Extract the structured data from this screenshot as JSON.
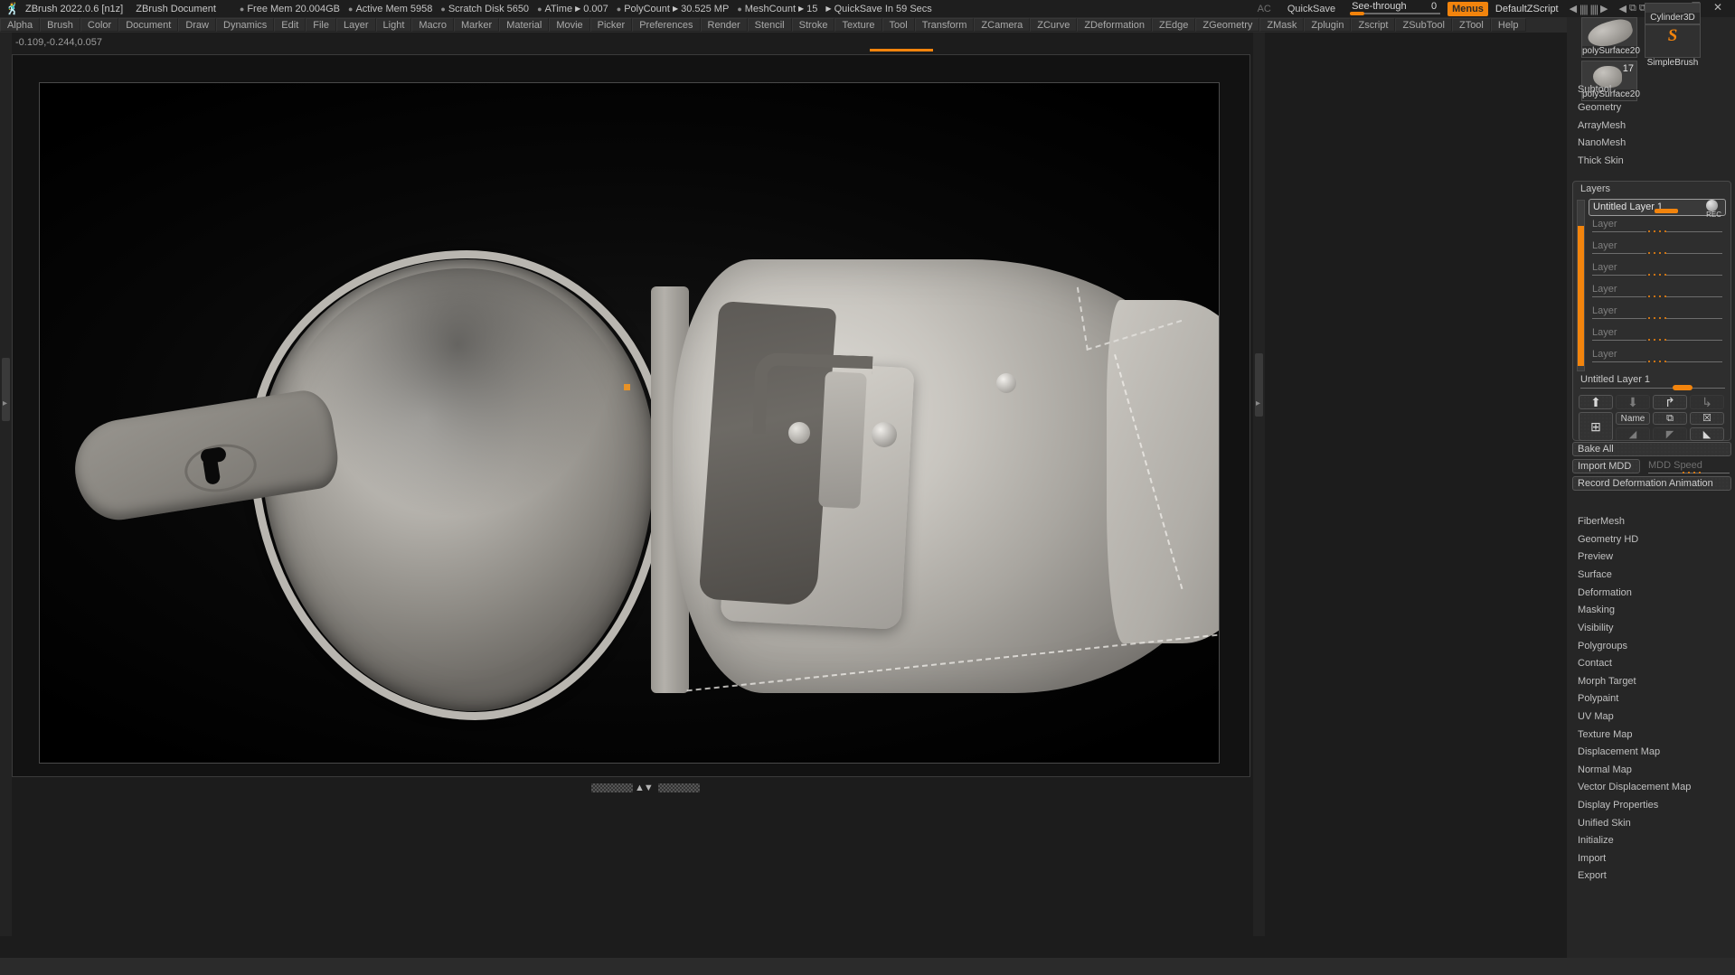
{
  "app": {
    "logo_icon": "zbrush-logo-icon",
    "version": "ZBrush 2022.0.6 [n1z]",
    "document_title": "ZBrush Document"
  },
  "titlebar": {
    "stats": [
      {
        "label": "Free Mem",
        "value": "20.004GB",
        "bullet": "•"
      },
      {
        "label": "Active Mem",
        "value": "5958",
        "bullet": "•"
      },
      {
        "label": "Scratch Disk",
        "value": "5650",
        "bullet": "•"
      },
      {
        "label": "ATime",
        "value": "0.007",
        "bullet": "•",
        "arrow": "▶"
      },
      {
        "label": "PolyCount",
        "value": "30.525 MP",
        "bullet": "•",
        "arrow": "▶"
      },
      {
        "label": "MeshCount",
        "value": "15",
        "bullet": "•",
        "arrow": "▶"
      },
      {
        "label": "QuickSave In 59 Secs",
        "value": "",
        "bullet": "",
        "arrow": "▶"
      }
    ],
    "ac_label": "AC",
    "quicksave_label": "QuickSave",
    "see_through_label": "See-through",
    "see_through_value": "0",
    "menus_label": "Menus",
    "zscript_label": "DefaultZScript",
    "minimize_icon": "minimize-icon",
    "restore_icon": "restore-icon",
    "close_icon": "close-icon",
    "accent_color": "#f2840d"
  },
  "menubar": {
    "items": [
      "Alpha",
      "Brush",
      "Color",
      "Document",
      "Draw",
      "Dynamics",
      "Edit",
      "File",
      "Layer",
      "Light",
      "Macro",
      "Marker",
      "Material",
      "Movie",
      "Picker",
      "Preferences",
      "Render",
      "Stencil",
      "Stroke",
      "Texture",
      "Tool",
      "Transform",
      "ZCamera",
      "ZCurve",
      "ZDeformation",
      "ZEdge",
      "ZGeometry",
      "ZMask",
      "Zplugin",
      "Zscript",
      "ZSubTool",
      "ZTool",
      "Help"
    ]
  },
  "canvas": {
    "coordinate_readout": "-0.109,-0.244,0.057",
    "subject": "leather saddlebag / holster 3d sculpt"
  },
  "sidebar": {
    "shelf": {
      "tool_thumb_1_label": "polySurface20",
      "tool_thumb_2_label": "polySurface20",
      "tool_thumb_2_count": "17",
      "brush_top_label": "Cylinder3D",
      "brush_label": "SimpleBrush"
    },
    "items_top": [
      "Subtool",
      "Geometry",
      "ArrayMesh",
      "NanoMesh",
      "Thick Skin"
    ],
    "items_bottom": [
      "FiberMesh",
      "Geometry HD",
      "Preview",
      "Surface",
      "Deformation",
      "Masking",
      "Visibility",
      "Polygroups",
      "Contact",
      "Morph Target",
      "Polypaint",
      "UV Map",
      "Texture Map",
      "Displacement Map",
      "Normal Map",
      "Vector Displacement Map",
      "Display Properties",
      "Unified Skin",
      "Initialize",
      "Import",
      "Export"
    ]
  },
  "layers_palette": {
    "title": "Layers",
    "active_layer_name": "Untitled Layer 1",
    "rec_label": "REC",
    "rows": [
      {
        "name": "Untitled Layer 1",
        "active": true
      },
      {
        "name": "Layer",
        "active": false
      },
      {
        "name": "Layer",
        "active": false
      },
      {
        "name": "Layer",
        "active": false
      },
      {
        "name": "Layer",
        "active": false
      },
      {
        "name": "Layer",
        "active": false
      },
      {
        "name": "Layer",
        "active": false
      },
      {
        "name": "Layer",
        "active": false
      }
    ],
    "footer_layer_name": "Untitled Layer 1",
    "buttons_row1": [
      {
        "name": "move-layer-up",
        "glyph": "⬆",
        "dim": false
      },
      {
        "name": "move-layer-down",
        "glyph": "⬇",
        "dim": true
      },
      {
        "name": "split-layer",
        "glyph": "↱",
        "dim": false
      },
      {
        "name": "merge-down-layer",
        "glyph": "↳",
        "dim": true
      }
    ],
    "buttons_row2": [
      {
        "name": "new-layer",
        "glyph": "⊞",
        "dim": false
      },
      {
        "name": "rename-layer",
        "glyph": "Name",
        "dim": false
      },
      {
        "name": "duplicate-layer",
        "glyph": "⧉",
        "dim": false
      },
      {
        "name": "delete-layer",
        "glyph": "☒",
        "dim": false
      }
    ],
    "buttons_row3": [
      {
        "name": "layer-intensity",
        "glyph": "◢",
        "dim": true
      },
      {
        "name": "layer-invert",
        "glyph": "◤",
        "dim": true
      },
      {
        "name": "layer-fill",
        "glyph": "◣",
        "dim": false
      }
    ],
    "bake_all_label": "Bake All",
    "import_mdd_label": "Import MDD",
    "mdd_speed_label": "MDD Speed",
    "record_deformation_label": "Record Deformation Animation"
  }
}
